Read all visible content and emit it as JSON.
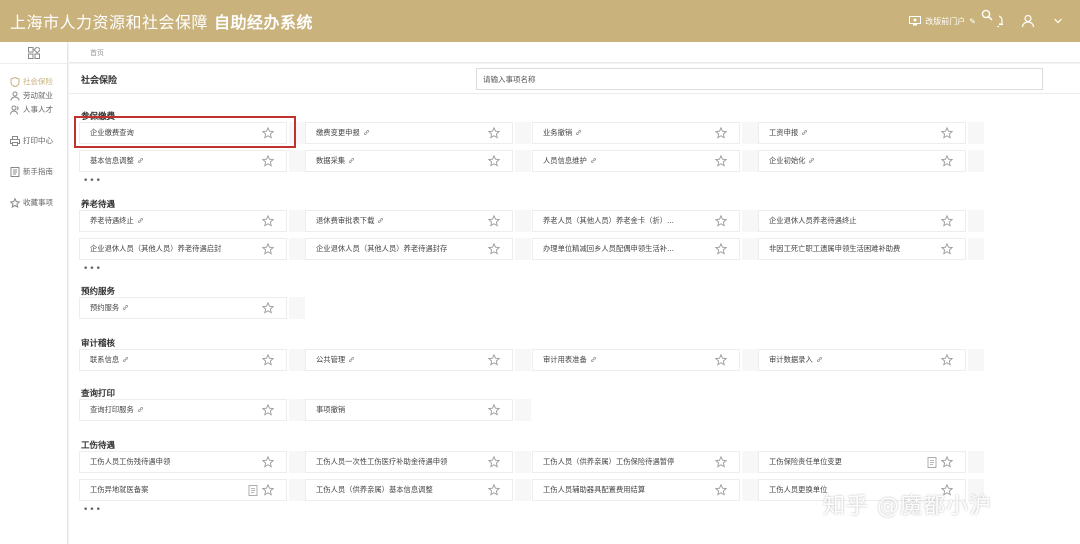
{
  "header": {
    "title": "上海市人力资源和社会保障",
    "subtitle": "自助经办系统",
    "portal_label": "改版前门户"
  },
  "sidebar": {
    "items": [
      {
        "label": "社会保险",
        "icon": "shield-icon",
        "active": true
      },
      {
        "label": "劳动就业",
        "icon": "user-icon"
      },
      {
        "label": "人事人才",
        "icon": "users-icon"
      },
      {
        "label": "打印中心",
        "icon": "printer-icon"
      },
      {
        "label": "新手指南",
        "icon": "guide-icon"
      },
      {
        "label": "收藏事项",
        "icon": "star-icon"
      }
    ]
  },
  "breadcrumb": "首页",
  "topbar": {
    "title": "社会保险",
    "search_placeholder": "请输入事项名称"
  },
  "more_label": "•••",
  "sections": [
    {
      "title": "参保缴费",
      "rows": [
        [
          {
            "label": "企业缴费查询"
          },
          {
            "label": "缴费变更申报",
            "link": true
          },
          {
            "label": "业务撤销",
            "link": true
          },
          {
            "label": "工资申报",
            "link": true
          }
        ],
        [
          {
            "label": "基本信息调整",
            "link": true
          },
          {
            "label": "数据采集",
            "link": true
          },
          {
            "label": "人员信息维护",
            "link": true
          },
          {
            "label": "企业初始化",
            "link": true
          }
        ]
      ],
      "more": true
    },
    {
      "title": "养老待遇",
      "rows": [
        [
          {
            "label": "养老待遇终止",
            "link": true
          },
          {
            "label": "退休费审批表下载",
            "link": true
          },
          {
            "label": "养老人员（其他人员）养老金卡（折）..."
          },
          {
            "label": "企业退休人员养老待遇终止"
          }
        ],
        [
          {
            "label": "企业退休人员（其他人员）养老待遇启封"
          },
          {
            "label": "企业退休人员（其他人员）养老待遇封存"
          },
          {
            "label": "办理单位精减回乡人员配偶申领生活补..."
          },
          {
            "label": "非因工死亡职工遗属申领生活困难补助费"
          }
        ]
      ],
      "more": true
    },
    {
      "title": "预约服务",
      "rows": [
        [
          {
            "label": "预约服务",
            "link": true
          }
        ]
      ]
    },
    {
      "title": "审计稽核",
      "rows": [
        [
          {
            "label": "联系信息",
            "link": true
          },
          {
            "label": "公共管理",
            "link": true
          },
          {
            "label": "审计用表准备",
            "link": true
          },
          {
            "label": "审计数据录入",
            "link": true
          }
        ]
      ]
    },
    {
      "title": "查询打印",
      "rows": [
        [
          {
            "label": "查询打印服务",
            "link": true
          },
          {
            "label": "事项撤销"
          }
        ]
      ]
    },
    {
      "title": "工伤待遇",
      "rows": [
        [
          {
            "label": "工伤人员工伤残待遇申领"
          },
          {
            "label": "工伤人员一次性工伤医疗补助金待遇申领"
          },
          {
            "label": "工伤人员（供养亲属）工伤保险待遇暂停"
          },
          {
            "label": "工伤保险责任单位变更",
            "doc": true
          }
        ],
        [
          {
            "label": "工伤异地就医备案",
            "doc": true
          },
          {
            "label": "工伤人员（供养亲属）基本信息调整"
          },
          {
            "label": "工伤人员辅助器具配置费用结算"
          },
          {
            "label": "工伤人员更换单位"
          }
        ]
      ],
      "more": true
    }
  ],
  "watermark": "知乎 @魔都小沪",
  "colors": {
    "brand": "#c9b27c",
    "highlight": "#c0322e"
  }
}
